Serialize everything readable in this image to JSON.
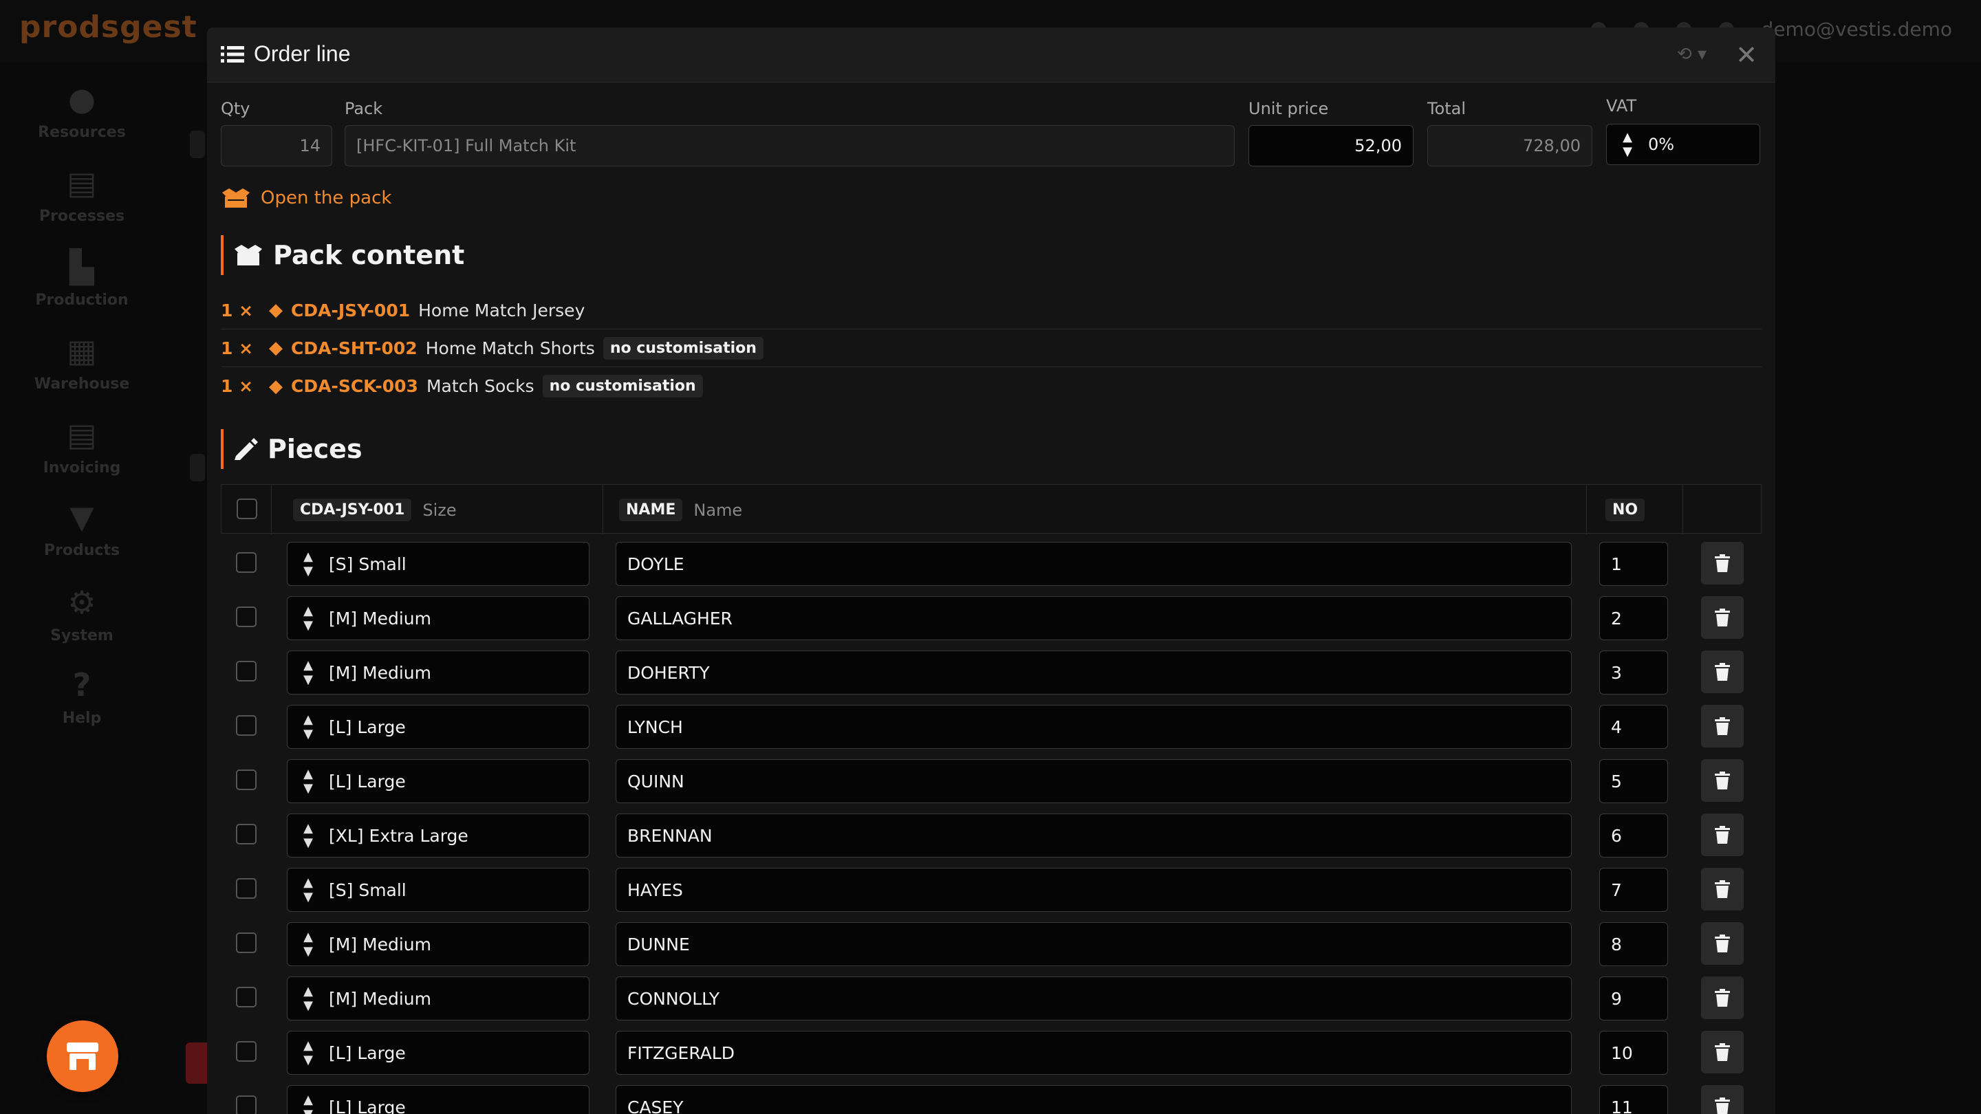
{
  "app": {
    "brand": "prodsgest",
    "user_email": "demo@vestis.demo"
  },
  "sidebar": {
    "items": [
      {
        "label": "Resources",
        "icon": "person-icon"
      },
      {
        "label": "Processes",
        "icon": "clipboard-icon"
      },
      {
        "label": "Production",
        "icon": "factory-icon"
      },
      {
        "label": "Warehouse",
        "icon": "warehouse-icon"
      },
      {
        "label": "Invoicing",
        "icon": "document-icon"
      },
      {
        "label": "Products",
        "icon": "tshirt-icon"
      },
      {
        "label": "System",
        "icon": "gears-icon"
      },
      {
        "label": "Help",
        "icon": "help-icon"
      }
    ]
  },
  "modal": {
    "title": "Order line",
    "fields": {
      "qty_label": "Qty",
      "qty_value": "14",
      "pack_label": "Pack",
      "pack_value": "[HFC-KIT-01] Full Match Kit",
      "unit_price_label": "Unit price",
      "unit_price_value": "52,00",
      "total_label": "Total",
      "total_value": "728,00",
      "vat_label": "VAT",
      "vat_value": "0%"
    },
    "open_pack_label": "Open the pack",
    "pack_content_title": "Pack content",
    "pack_items": [
      {
        "qty": "1 ×",
        "code": "CDA-JSY-001",
        "name": "Home Match Jersey",
        "badge": ""
      },
      {
        "qty": "1 ×",
        "code": "CDA-SHT-002",
        "name": "Home Match Shorts",
        "badge": "no customisation"
      },
      {
        "qty": "1 ×",
        "code": "CDA-SCK-003",
        "name": "Match Socks",
        "badge": "no customisation"
      }
    ],
    "pieces_title": "Pieces",
    "table": {
      "col_product_badge": "CDA-JSY-001",
      "col_size": "Size",
      "col_name_badge": "NAME",
      "col_name": "Name",
      "col_no_badge": "NO",
      "rows": [
        {
          "size": "[S] Small",
          "name": "DOYLE",
          "no": "1"
        },
        {
          "size": "[M] Medium",
          "name": "GALLAGHER",
          "no": "2"
        },
        {
          "size": "[M] Medium",
          "name": "DOHERTY",
          "no": "3"
        },
        {
          "size": "[L] Large",
          "name": "LYNCH",
          "no": "4"
        },
        {
          "size": "[L] Large",
          "name": "QUINN",
          "no": "5"
        },
        {
          "size": "[XL] Extra Large",
          "name": "BRENNAN",
          "no": "6"
        },
        {
          "size": "[S] Small",
          "name": "HAYES",
          "no": "7"
        },
        {
          "size": "[M] Medium",
          "name": "DUNNE",
          "no": "8"
        },
        {
          "size": "[M] Medium",
          "name": "CONNOLLY",
          "no": "9"
        },
        {
          "size": "[L] Large",
          "name": "FITZGERALD",
          "no": "10"
        },
        {
          "size": "[L] Large",
          "name": "CASEY",
          "no": "11"
        }
      ]
    }
  },
  "colors": {
    "accent": "#f26d21",
    "accent_text": "#f28a2e"
  }
}
